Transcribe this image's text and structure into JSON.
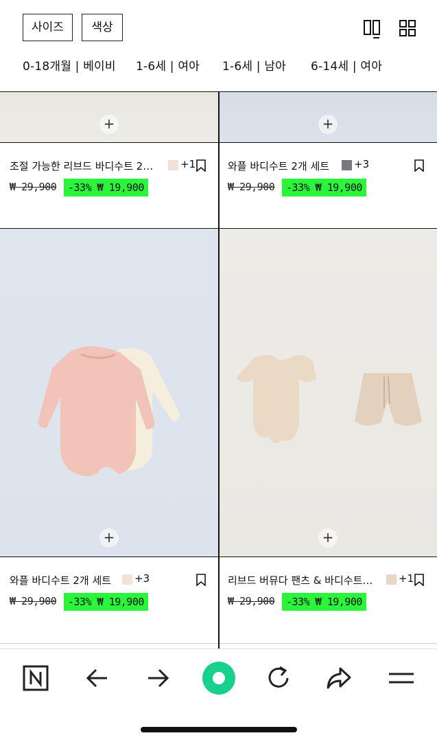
{
  "filters": {
    "size_label": "사이즈",
    "color_label": "색상"
  },
  "categories": [
    "0-18개월 | 베이비",
    "1-6세 | 여아",
    "1-6세 | 남아",
    "6-14세 | 여아"
  ],
  "products": [
    {
      "title": "조절 가능한 리브드 바디수트 2…",
      "swatch_color": "#f1e1d8",
      "more": "+1",
      "old_price": "₩ 29,900",
      "sale": "-33%  ₩ 19,900"
    },
    {
      "title": "와플 바디수트 2개 세트",
      "swatch_color": "#777b7f",
      "more": "+3",
      "old_price": "₩ 29,900",
      "sale": "-33%  ₩ 19,900"
    },
    {
      "title": "와플 바디수트 2개 세트",
      "swatch_color": "#f3e2da",
      "more": "+3",
      "old_price": "₩ 29,900",
      "sale": "-33%  ₩ 19,900"
    },
    {
      "title": "리브드 버뮤다 팬츠 & 바디수트…",
      "swatch_color": "#e8d7c4",
      "more": "+1",
      "old_price": "₩ 29,900",
      "sale": "-33%  ₩ 19,900"
    }
  ],
  "colors": {
    "sale_bg": "#2bf53a",
    "accent": "#16d08c"
  },
  "icons": [
    "view-two-column-icon",
    "view-four-grid-icon",
    "plus-icon",
    "bookmark-icon",
    "naver-n-icon",
    "back-arrow-icon",
    "forward-arrow-icon",
    "green-dot-icon",
    "refresh-icon",
    "share-icon",
    "menu-icon"
  ]
}
